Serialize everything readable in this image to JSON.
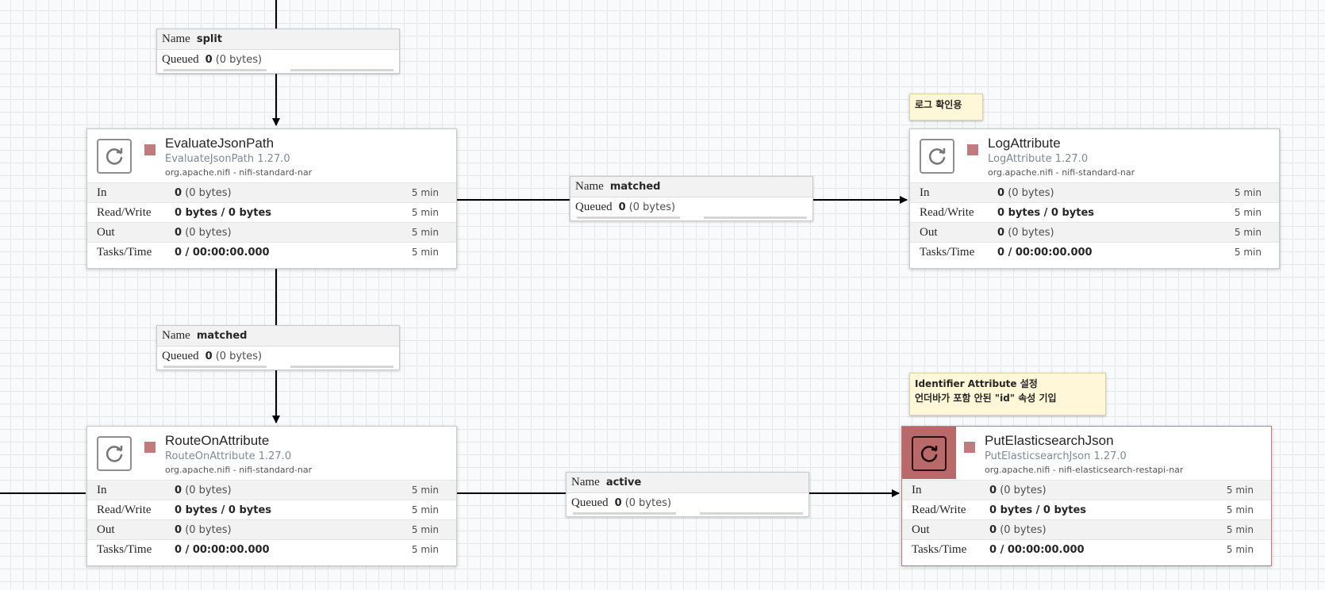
{
  "labels": [
    {
      "id": "log-note",
      "lines": [
        "로그 확인용"
      ]
    },
    {
      "id": "es-note",
      "lines": [
        "Identifier Attribute 설정",
        "언더바가 포함 안된 \"id\" 속성 기입"
      ]
    }
  ],
  "connections": [
    {
      "id": "split",
      "name_key": "Name",
      "name": "split",
      "queued_key": "Queued",
      "queued_count": "0",
      "queued_bytes": "(0 bytes)"
    },
    {
      "id": "matched-right",
      "name_key": "Name",
      "name": "matched",
      "queued_key": "Queued",
      "queued_count": "0",
      "queued_bytes": "(0 bytes)"
    },
    {
      "id": "matched-down",
      "name_key": "Name",
      "name": "matched",
      "queued_key": "Queued",
      "queued_count": "0",
      "queued_bytes": "(0 bytes)"
    },
    {
      "id": "active",
      "name_key": "Name",
      "name": "active",
      "queued_key": "Queued",
      "queued_count": "0",
      "queued_bytes": "(0 bytes)"
    }
  ],
  "processors": [
    {
      "id": "evaluate",
      "name": "EvaluateJsonPath",
      "version": "EvaluateJsonPath 1.27.0",
      "bundle": "org.apache.nifi - nifi-standard-nar",
      "stats": {
        "in_label": "In",
        "in_count": "0",
        "in_bytes": "(0 bytes)",
        "rw_label": "Read/Write",
        "rw": "0 bytes / 0 bytes",
        "out_label": "Out",
        "out_count": "0",
        "out_bytes": "(0 bytes)",
        "tasks_label": "Tasks/Time",
        "tasks": "0 / 00:00:00.000",
        "window": "5 min"
      }
    },
    {
      "id": "log",
      "name": "LogAttribute",
      "version": "LogAttribute 1.27.0",
      "bundle": "org.apache.nifi - nifi-standard-nar",
      "stats": {
        "in_label": "In",
        "in_count": "0",
        "in_bytes": "(0 bytes)",
        "rw_label": "Read/Write",
        "rw": "0 bytes / 0 bytes",
        "out_label": "Out",
        "out_count": "0",
        "out_bytes": "(0 bytes)",
        "tasks_label": "Tasks/Time",
        "tasks": "0 / 00:00:00.000",
        "window": "5 min"
      }
    },
    {
      "id": "route",
      "name": "RouteOnAttribute",
      "version": "RouteOnAttribute 1.27.0",
      "bundle": "org.apache.nifi - nifi-standard-nar",
      "stats": {
        "in_label": "In",
        "in_count": "0",
        "in_bytes": "(0 bytes)",
        "rw_label": "Read/Write",
        "rw": "0 bytes / 0 bytes",
        "out_label": "Out",
        "out_count": "0",
        "out_bytes": "(0 bytes)",
        "tasks_label": "Tasks/Time",
        "tasks": "0 / 00:00:00.000",
        "window": "5 min"
      }
    },
    {
      "id": "put-es",
      "name": "PutElasticsearchJson",
      "version": "PutElasticsearchJson 1.27.0",
      "bundle": "org.apache.nifi - nifi-elasticsearch-restapi-nar",
      "stats": {
        "in_label": "In",
        "in_count": "0",
        "in_bytes": "(0 bytes)",
        "rw_label": "Read/Write",
        "rw": "0 bytes / 0 bytes",
        "out_label": "Out",
        "out_count": "0",
        "out_bytes": "(0 bytes)",
        "tasks_label": "Tasks/Time",
        "tasks": "0 / 00:00:00.000",
        "window": "5 min"
      }
    }
  ],
  "colors": {
    "stopped": "#c27b7d",
    "selected_icon_bg": "#b9696a",
    "label_bg": "#fff7d7",
    "canvas_bg": "#f9fafb",
    "grid": "#e3e8eb"
  }
}
